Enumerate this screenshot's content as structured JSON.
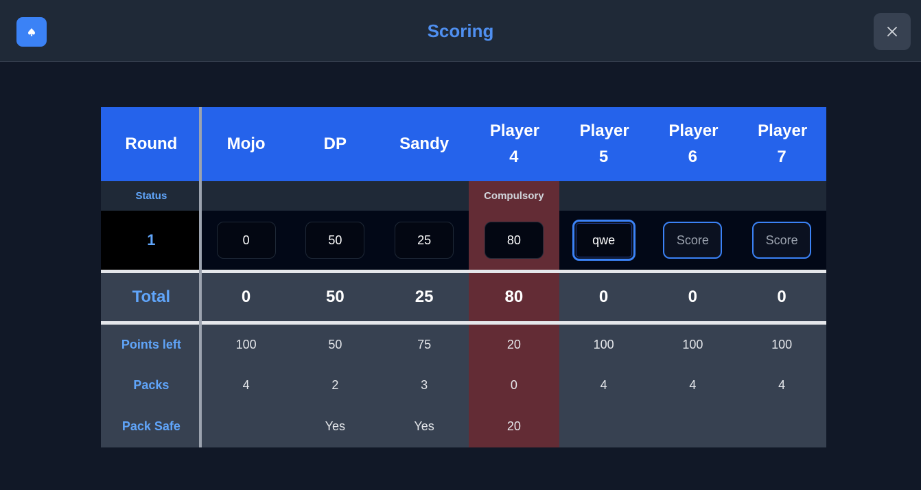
{
  "app": {
    "title": "Scoring",
    "icon": "spade-icon",
    "close_icon": "close-icon"
  },
  "colors": {
    "accent": "#2563eb",
    "highlight": "#632c35",
    "label": "#60a5fa",
    "background": "#111827"
  },
  "table": {
    "header": {
      "round_label": "Round",
      "players": [
        "Mojo",
        "DP",
        "Sandy",
        "Player 4",
        "Player 5",
        "Player 6",
        "Player 7"
      ]
    },
    "status": {
      "label": "Status",
      "values": [
        "",
        "",
        "",
        "Compulsory",
        "",
        "",
        ""
      ]
    },
    "rounds": [
      {
        "number": "1",
        "scores": [
          "0",
          "50",
          "25",
          "80",
          "qwe",
          "",
          ""
        ],
        "placeholder": "Score"
      }
    ],
    "total": {
      "label": "Total",
      "values": [
        "0",
        "50",
        "25",
        "80",
        "0",
        "0",
        "0"
      ]
    },
    "points_left": {
      "label": "Points left",
      "values": [
        "100",
        "50",
        "75",
        "20",
        "100",
        "100",
        "100"
      ]
    },
    "packs": {
      "label": "Packs",
      "values": [
        "4",
        "2",
        "3",
        "0",
        "4",
        "4",
        "4"
      ]
    },
    "pack_safe": {
      "label": "Pack Safe",
      "values": [
        "",
        "Yes",
        "Yes",
        "20",
        "",
        "",
        ""
      ]
    }
  }
}
